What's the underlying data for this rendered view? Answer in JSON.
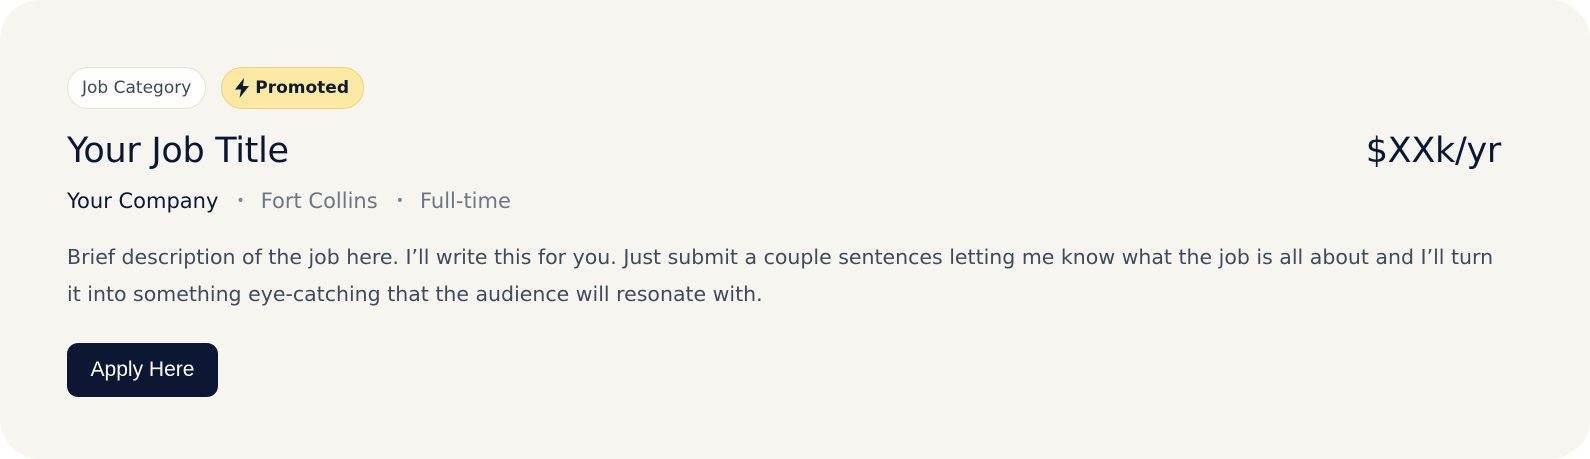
{
  "card": {
    "category_tag": "Job Category",
    "promoted_tag": "Promoted",
    "promoted_icon": "lightning-bolt-icon",
    "title": "Your Job Title",
    "salary": "$XXk/yr",
    "company": "Your Company",
    "separator": "•",
    "location": "Fort Collins",
    "employment_type": "Full-time",
    "description": "Brief description of the job here. I’ll write this for you. Just submit a couple sentences letting me know what the job is all about and I’ll turn it into something eye-catching that the audience will resonate with.",
    "apply_label": "Apply Here"
  },
  "colors": {
    "card_background": "#f6f5f0",
    "promoted_background": "#fde9a3",
    "primary_dark": "#0b1733",
    "muted_text": "#6c7685"
  }
}
